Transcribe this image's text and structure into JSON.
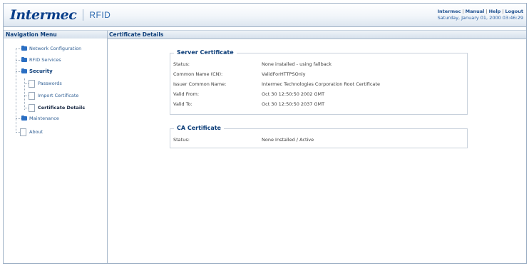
{
  "header": {
    "logo_text": "Intermec",
    "logo_sub": "RFID",
    "links": [
      "Intermec",
      "Manual",
      "Help",
      "Logout"
    ],
    "datetime": "Saturday, January 01, 2000 03:46:29"
  },
  "titlebar": {
    "nav_title": "Navigation Menu",
    "content_title": "Certificate Details"
  },
  "nav": {
    "network_configuration": "Network Configuration",
    "rfid_services": "RFID Services",
    "security": "Security",
    "passwords": "Passwords",
    "import_certificate": "Import Certificate",
    "certificate_details": "Certificate Details",
    "maintenance": "Maintenance",
    "about": "About"
  },
  "server_certificate": {
    "title": "Server Certificate",
    "rows": [
      {
        "label": "Status:",
        "value": "None installed - using fallback"
      },
      {
        "label": "Common Name (CN):",
        "value": "ValidForHTTPSOnly"
      },
      {
        "label": "Issuer Common Name:",
        "value": "Intermec Technologies Corporation Root Certificate"
      },
      {
        "label": "Valid From:",
        "value": "Oct 30 12:50:50 2002 GMT"
      },
      {
        "label": "Valid To:",
        "value": "Oct 30 12:50:50 2037 GMT"
      }
    ]
  },
  "ca_certificate": {
    "title": "CA Certificate",
    "rows": [
      {
        "label": "Status:",
        "value": "None Installed / Active"
      }
    ]
  }
}
